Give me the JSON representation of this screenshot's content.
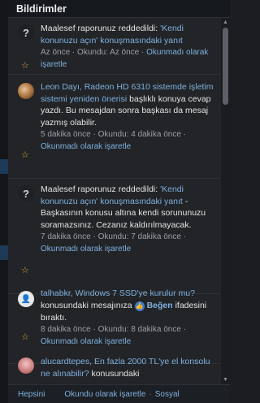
{
  "header": {
    "title": "Bildirimler"
  },
  "notifications": [
    {
      "avatar": "?",
      "lines": [
        "Maalesef raporunuz reddedildi: ",
        "'Kendi konunuzu açın' konuşmasındaki yanıt"
      ],
      "meta_time": "Az önce",
      "meta_sep": "·",
      "meta_read": "Okundu: Az önce",
      "meta_action": "Okunmadı olarak işaretle"
    },
    {
      "avatar": "img",
      "line1": "Leon Dayı, Radeon HD 6310 sistemde işletim sistemi yeniden önerisi",
      "line2": " başlıklı konuya cevap yazdı. Bu mesajdan sonra başkası da mesaj yazmış olabilir.",
      "meta_time": "5 dakika önce",
      "meta_read": "Okundu: 4 dakika önce",
      "meta_action": "Okunmadı olarak işaretle"
    },
    {
      "avatar": "?",
      "line1": "Maalesef raporunuz reddedildi: ",
      "line1_link": "'Kendi konunuzu açın' konuşmasındaki yanıt",
      "line2": " - Başkasının konusu altına kendi sorununuzu soramazsınız. Cezanız kaldırılmayacak.",
      "meta_time": "7 dakika önce",
      "meta_read": "Okundu: 7 dakika önce",
      "meta_action": "Okunmadı olarak işaretle"
    },
    {
      "avatar": "img",
      "user": "talhabkr",
      "line1_link": ", Windows 7 SSD'ye kurulur mu?",
      "line2": " konusundaki mesajınıza ",
      "reaction": "Beğen",
      "line3": " ifadesini bıraktı.",
      "meta_time": "8 dakika önce",
      "meta_read": "Okundu: 8 dakika önce",
      "meta_action": "Okunmadı olarak işaretle"
    },
    {
      "avatar": "img",
      "user": "alucardtepes",
      "line1_link": ", En fazla 2000 TL'ye el konsolu ne alınabilir?",
      "line2": " konusundaki"
    }
  ],
  "footer": {
    "all": "Hepsini",
    "mark_read": "Okundu olarak işaretle",
    "sep": "·",
    "social": "Sosyal"
  }
}
